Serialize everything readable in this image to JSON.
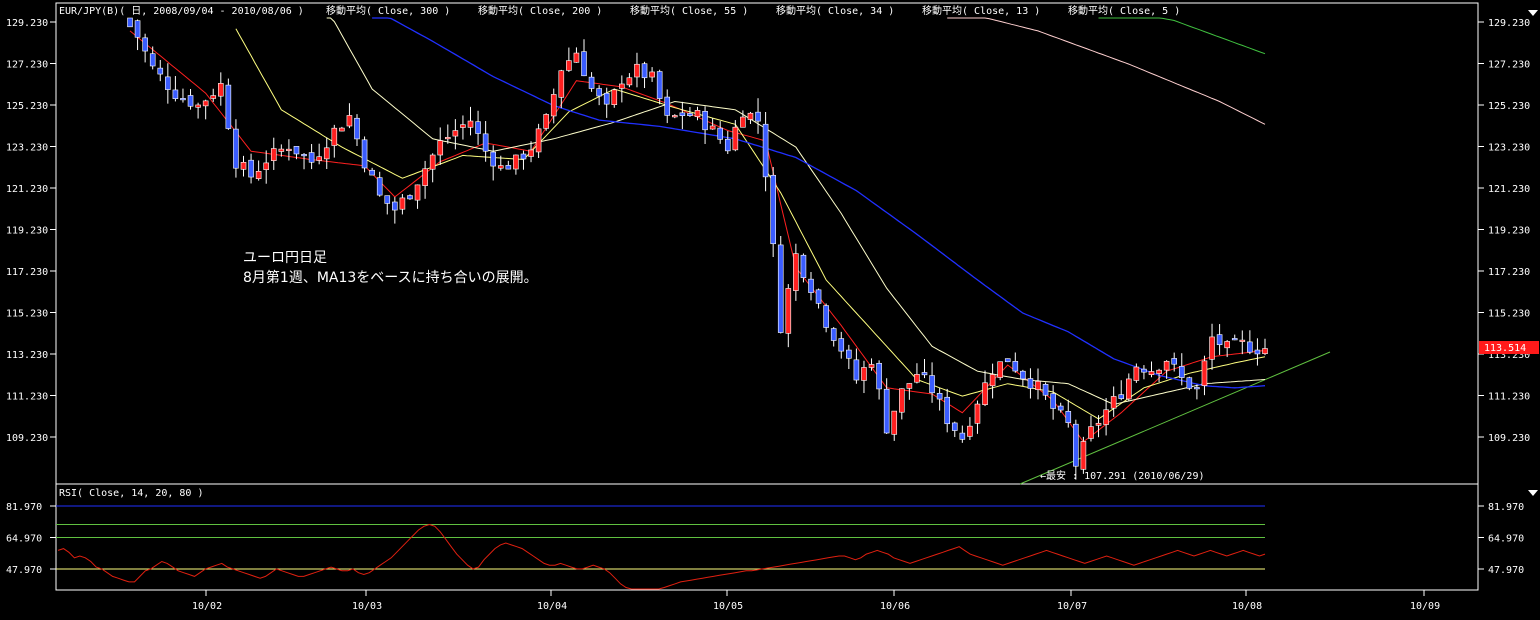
{
  "header": {
    "symbol": "EUR/JPY(B)( 日, 2008/09/04 - 2010/08/06 )",
    "ma_labels": [
      "移動平均( Close, 300 )",
      "移動平均( Close, 200 )",
      "移動平均( Close, 55 )",
      "移動平均( Close, 34 )",
      "移動平均( Close, 13 )",
      "移動平均( Close, 5 )"
    ]
  },
  "annotation": {
    "line1": "ユーロ円日足",
    "line2": "8月第1週、MA13をベースに持ち合いの展開。",
    "low_label": "←最安 : 107.291 (2010/06/29)"
  },
  "current_price": "113.514",
  "rsi_header": "RSI( Close, 14, 20, 80 )",
  "colors": {
    "up": "#ff2020",
    "down": "#3a5cff",
    "ma5": "#ff2020",
    "ma13": "#ffff80",
    "ma34": "#ffffcc",
    "ma55": "#2030ff",
    "ma200": "#ffd0d0",
    "ma300": "#40c040",
    "trendline": "#60c040",
    "rsi": "#e02010"
  },
  "chart_data": [
    {
      "type": "candlestick",
      "title": "EUR/JPY(B)( 日, 2008/09/04 - 2010/08/06 )",
      "x_tick_labels": [
        "10/02",
        "10/03",
        "10/04",
        "10/05",
        "10/06",
        "10/07",
        "10/08",
        "10/09"
      ],
      "y_tick_labels": [
        "129.230",
        "127.230",
        "125.230",
        "123.230",
        "121.230",
        "119.230",
        "117.230",
        "115.230",
        "113.230",
        "111.230",
        "109.230"
      ],
      "ylim": [
        107.9,
        129.9
      ],
      "last_close": 113.514,
      "period_low": {
        "value": 107.291,
        "date": "2010/06/29"
      },
      "close_path": [
        [
          0,
          129.3
        ],
        [
          3,
          127.0
        ],
        [
          6,
          125.8
        ],
        [
          9,
          125.2
        ],
        [
          12,
          126.2
        ],
        [
          14,
          122.5
        ],
        [
          16,
          121.8
        ],
        [
          18,
          122.6
        ],
        [
          21,
          123.3
        ],
        [
          24,
          122.5
        ],
        [
          27,
          124.0
        ],
        [
          29,
          124.7
        ],
        [
          31,
          122.5
        ],
        [
          33,
          120.8
        ],
        [
          35,
          120.2
        ],
        [
          37,
          121.0
        ],
        [
          39,
          122.2
        ],
        [
          41,
          123.4
        ],
        [
          43,
          124.0
        ],
        [
          45,
          124.5
        ],
        [
          47,
          123.0
        ],
        [
          49,
          122.2
        ],
        [
          51,
          122.5
        ],
        [
          53,
          123.2
        ],
        [
          55,
          124.5
        ],
        [
          57,
          127.0
        ],
        [
          59,
          127.8
        ],
        [
          61,
          126.0
        ],
        [
          63,
          125.0
        ],
        [
          65,
          126.5
        ],
        [
          67,
          126.9
        ],
        [
          69,
          126.5
        ],
        [
          71,
          124.5
        ],
        [
          73,
          124.8
        ],
        [
          75,
          124.7
        ],
        [
          77,
          124.0
        ],
        [
          79,
          123.2
        ],
        [
          81,
          125.0
        ],
        [
          83,
          124.5
        ],
        [
          84,
          122.0
        ],
        [
          86,
          114.6
        ],
        [
          88,
          118.0
        ],
        [
          90,
          116.5
        ],
        [
          92,
          114.8
        ],
        [
          94,
          113.5
        ],
        [
          96,
          112.0
        ],
        [
          98,
          113.0
        ],
        [
          100,
          109.7
        ],
        [
          102,
          111.4
        ],
        [
          104,
          112.3
        ],
        [
          106,
          111.5
        ],
        [
          108,
          110.1
        ],
        [
          110,
          109.2
        ],
        [
          112,
          111.0
        ],
        [
          114,
          112.5
        ],
        [
          116,
          113.0
        ],
        [
          118,
          112.2
        ],
        [
          120,
          111.6
        ],
        [
          122,
          110.6
        ],
        [
          124,
          109.8
        ],
        [
          125,
          107.9
        ],
        [
          127,
          109.5
        ],
        [
          129,
          110.5
        ],
        [
          131,
          111.4
        ],
        [
          133,
          112.7
        ],
        [
          135,
          112.5
        ],
        [
          137,
          113.0
        ],
        [
          139,
          112.0
        ],
        [
          141,
          111.5
        ],
        [
          143,
          114.0
        ],
        [
          145,
          113.5
        ],
        [
          147,
          113.7
        ],
        [
          149,
          113.5
        ],
        [
          150,
          113.514
        ]
      ],
      "series": [
        {
          "name": "移動平均( Close, 5 )",
          "path": [
            [
              0,
              128.8
            ],
            [
              10,
              125.8
            ],
            [
              16,
              123.0
            ],
            [
              24,
              122.6
            ],
            [
              31,
              122.3
            ],
            [
              35,
              120.8
            ],
            [
              41,
              122.5
            ],
            [
              47,
              123.4
            ],
            [
              53,
              123.0
            ],
            [
              59,
              126.4
            ],
            [
              65,
              126.1
            ],
            [
              71,
              125.3
            ],
            [
              79,
              124.0
            ],
            [
              84,
              123.5
            ],
            [
              88,
              117.4
            ],
            [
              94,
              114.6
            ],
            [
              100,
              111.6
            ],
            [
              106,
              111.3
            ],
            [
              110,
              110.4
            ],
            [
              116,
              112.7
            ],
            [
              122,
              111.0
            ],
            [
              126,
              109.0
            ],
            [
              131,
              110.4
            ],
            [
              137,
              112.4
            ],
            [
              143,
              113.1
            ],
            [
              150,
              113.4
            ]
          ]
        },
        {
          "name": "移動平均( Close, 13 )",
          "path": [
            [
              14,
              128.9
            ],
            [
              20,
              125.0
            ],
            [
              28,
              123.2
            ],
            [
              36,
              121.7
            ],
            [
              44,
              122.8
            ],
            [
              52,
              122.6
            ],
            [
              58,
              124.9
            ],
            [
              64,
              126.0
            ],
            [
              72,
              125.1
            ],
            [
              80,
              124.3
            ],
            [
              86,
              121.0
            ],
            [
              92,
              116.8
            ],
            [
              98,
              114.4
            ],
            [
              104,
              112.0
            ],
            [
              110,
              111.2
            ],
            [
              116,
              111.8
            ],
            [
              122,
              111.4
            ],
            [
              128,
              110.1
            ],
            [
              134,
              111.6
            ],
            [
              140,
              112.3
            ],
            [
              146,
              112.8
            ],
            [
              150,
              113.1
            ]
          ]
        },
        {
          "name": "移動平均( Close, 34 )",
          "path": [
            [
              26,
              129.9
            ],
            [
              32,
              126.0
            ],
            [
              40,
              123.6
            ],
            [
              48,
              123.0
            ],
            [
              56,
              123.6
            ],
            [
              64,
              124.4
            ],
            [
              72,
              125.4
            ],
            [
              80,
              125.0
            ],
            [
              88,
              123.2
            ],
            [
              94,
              120.0
            ],
            [
              100,
              116.4
            ],
            [
              106,
              113.6
            ],
            [
              112,
              112.4
            ],
            [
              118,
              112.0
            ],
            [
              124,
              111.8
            ],
            [
              130,
              110.8
            ],
            [
              136,
              111.3
            ],
            [
              142,
              111.8
            ],
            [
              150,
              112.0
            ]
          ]
        },
        {
          "name": "移動平均( Close, 55 )",
          "path": [
            [
              32,
              129.9
            ],
            [
              40,
              128.3
            ],
            [
              48,
              126.6
            ],
            [
              56,
              125.2
            ],
            [
              62,
              124.5
            ],
            [
              70,
              124.2
            ],
            [
              80,
              123.6
            ],
            [
              88,
              122.7
            ],
            [
              96,
              121.1
            ],
            [
              104,
              119.0
            ],
            [
              112,
              116.8
            ],
            [
              118,
              115.2
            ],
            [
              124,
              114.3
            ],
            [
              130,
              113.0
            ],
            [
              136,
              112.2
            ],
            [
              142,
              111.7
            ],
            [
              146,
              111.6
            ],
            [
              150,
              111.7
            ]
          ]
        },
        {
          "name": "移動平均( Close, 200 )",
          "path": [
            [
              108,
              129.9
            ],
            [
              120,
              128.8
            ],
            [
              132,
              127.2
            ],
            [
              144,
              125.4
            ],
            [
              150,
              124.3
            ]
          ]
        },
        {
          "name": "移動平均( Close, 300 )",
          "path": [
            [
              128,
              130.0
            ],
            [
              138,
              129.3
            ],
            [
              150,
              127.7
            ]
          ]
        }
      ]
    },
    {
      "type": "line",
      "title": "RSI( Close, 14, 20, 80 )",
      "y_tick_labels": [
        "81.970",
        "64.970",
        "47.970"
      ],
      "ylim": [
        41.0,
        86.0
      ],
      "reference_lines": [
        81.97,
        72.0,
        64.97,
        47.97
      ],
      "series": [
        {
          "name": "RSI",
          "values": [
            58,
            59,
            57,
            54,
            55,
            54,
            52,
            49,
            48,
            46,
            44,
            43,
            42,
            41,
            41,
            44,
            47,
            48,
            50,
            52,
            51,
            49,
            47,
            46,
            45,
            44,
            46,
            48,
            49,
            50,
            51,
            49,
            48,
            47,
            46,
            45,
            44,
            43,
            44,
            46,
            48,
            47,
            46,
            45,
            44,
            44,
            45,
            46,
            47,
            48,
            49,
            48,
            47,
            47,
            48,
            46,
            45,
            46,
            48,
            50,
            52,
            54,
            57,
            60,
            63,
            66,
            69,
            71,
            72,
            71,
            68,
            64,
            60,
            56,
            53,
            50,
            48,
            49,
            53,
            56,
            59,
            61,
            62,
            61,
            60,
            59,
            57,
            55,
            53,
            51,
            50,
            50,
            51,
            50,
            49,
            48,
            48,
            49,
            50,
            49,
            48,
            46,
            43,
            40,
            38,
            36,
            35,
            34,
            35,
            36,
            37,
            38,
            39,
            40,
            41,
            41.5,
            42,
            42.5,
            43,
            43.5,
            44,
            44.5,
            45,
            45.5,
            46,
            46.5,
            47,
            47,
            47.5,
            48,
            48.5,
            49,
            49.5,
            50,
            50.5,
            51,
            51.5,
            52,
            52.5,
            53,
            53.5,
            54,
            54.5,
            55,
            55,
            54,
            53,
            54,
            56,
            57,
            58,
            57,
            56,
            54,
            53,
            52,
            51,
            52,
            53,
            54,
            55,
            56,
            57,
            58,
            59,
            60,
            58,
            56,
            55,
            54,
            53,
            52,
            51,
            50,
            51,
            52,
            53,
            54,
            55,
            56,
            57,
            58,
            57,
            56,
            55,
            54,
            53,
            52,
            51,
            52,
            53,
            54,
            55,
            54,
            53,
            52,
            51,
            50,
            51,
            52,
            53,
            54,
            55,
            56,
            57,
            58,
            57,
            56,
            55,
            56,
            57,
            58,
            57,
            56,
            55,
            56,
            57,
            58,
            57,
            56,
            55,
            56
          ]
        }
      ]
    }
  ]
}
